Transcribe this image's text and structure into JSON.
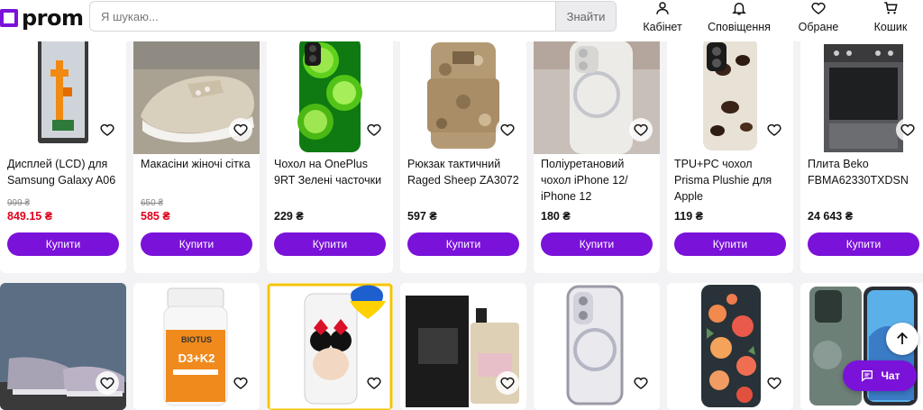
{
  "header": {
    "logo_text": "prom",
    "search_placeholder": "Я шукаю...",
    "search_button": "Знайти",
    "nav": {
      "cabinet": "Кабінет",
      "notifications": "Сповіщення",
      "favorites": "Обране",
      "cart": "Кошик"
    }
  },
  "row1": [
    {
      "title": "Дисплей (LCD) для Samsung Galaxy A06",
      "old_price": "999 ₴",
      "price": "849.15 ₴",
      "sale": true,
      "buy": "Купити",
      "image": "lcd-display-photo"
    },
    {
      "title": "Макасіни жіночі сітка",
      "old_price": "650 ₴",
      "price": "585 ₴",
      "sale": true,
      "buy": "Купити",
      "image": "sneakers-photo"
    },
    {
      "title": "Чохол на OnePlus 9RT Зелені часточки",
      "old_price": "",
      "price": "229 ₴",
      "sale": false,
      "buy": "Купити",
      "image": "lime-phone-case-photo"
    },
    {
      "title": "Рюкзак тактичний Raged Sheep ZA3072",
      "old_price": "",
      "price": "597 ₴",
      "sale": false,
      "buy": "Купити",
      "image": "tactical-backpack-photo"
    },
    {
      "title": "Поліуретановий чохол iPhone 12/ iPhone 12",
      "old_price": "",
      "price": "180 ₴",
      "sale": false,
      "buy": "Купити",
      "image": "magsafe-case-photo"
    },
    {
      "title": "TPU+PC чохол Prisma Plushie для Apple",
      "old_price": "",
      "price": "119 ₴",
      "sale": false,
      "buy": "Купити",
      "image": "coffee-phone-case-photo"
    },
    {
      "title": "Плита Beko FBMA62330TXDSN",
      "old_price": "",
      "price": "24 643 ₴",
      "sale": false,
      "buy": "Купити",
      "image": "stove-photo"
    }
  ],
  "row2": [
    {
      "image": "running-shoes-photo"
    },
    {
      "image": "vitamin-bottle-photo",
      "bottle_brand": "BIOTUS",
      "bottle_product": "D3+K2"
    },
    {
      "image": "minnie-phone-case-photo"
    },
    {
      "image": "perfume-photo"
    },
    {
      "image": "clear-iphone-case-photo"
    },
    {
      "image": "floral-phone-case-photo"
    },
    {
      "image": "armored-phone-case-photo"
    }
  ],
  "floating": {
    "chat_label": "Чат"
  },
  "colors": {
    "accent": "#7a12d9",
    "sale": "#e0001b"
  }
}
